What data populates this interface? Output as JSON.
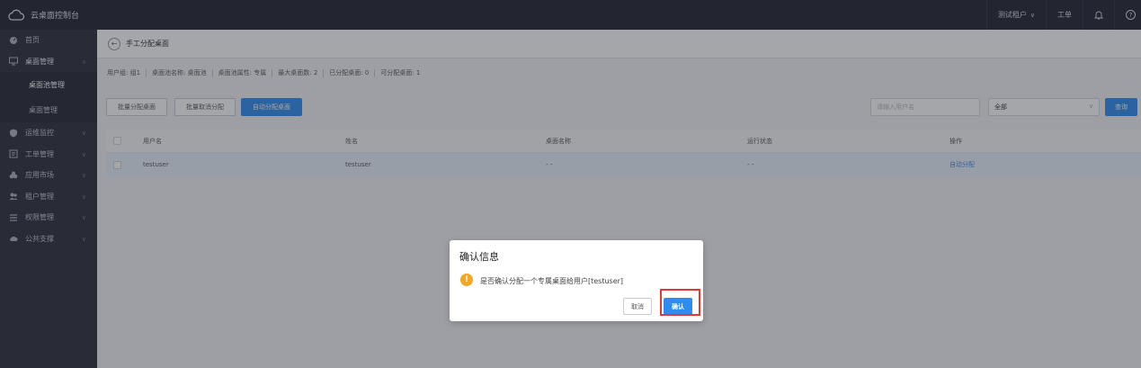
{
  "topbar": {
    "app_title": "云桌面控制台",
    "user": "测试租户",
    "ticket": "工单"
  },
  "sidebar": {
    "items": [
      {
        "label": "首页",
        "icon": "dashboard-icon"
      },
      {
        "label": "桌面管理",
        "icon": "monitor-icon",
        "expanded": true,
        "children": [
          {
            "label": "桌面池管理",
            "active": true
          },
          {
            "label": "桌面管理",
            "active": false
          }
        ]
      },
      {
        "label": "运维监控",
        "icon": "shield-icon"
      },
      {
        "label": "工单管理",
        "icon": "ticket-icon"
      },
      {
        "label": "应用市场",
        "icon": "app-market-icon"
      },
      {
        "label": "租户管理",
        "icon": "tenant-icon"
      },
      {
        "label": "权限管理",
        "icon": "permission-icon"
      },
      {
        "label": "公共支撑",
        "icon": "cloud-icon"
      }
    ]
  },
  "page": {
    "title": "手工分配桌面",
    "info": [
      "用户组: 组1",
      "桌面池名称: 桌面池",
      "桌面池属性: 专属",
      "最大桌面数: 2",
      "已分配桌面: 0",
      "可分配桌面: 1"
    ]
  },
  "toolbar": {
    "batch_assign": "批量分配桌面",
    "batch_unassign": "批量取消分配",
    "auto_assign": "自动分配桌面",
    "search_placeholder": "请输入用户名",
    "filter_value": "全部",
    "query": "查询"
  },
  "table": {
    "headers": [
      "用户名",
      "姓名",
      "桌面名称",
      "运行状态",
      "操作"
    ],
    "rows": [
      {
        "username": "testuser",
        "name": "testuser",
        "desktop": "- -",
        "status": "- -",
        "action": "自动分配"
      }
    ]
  },
  "dialog": {
    "title": "确认信息",
    "message": "是否确认分配一个专属桌面给用户[testuser]",
    "cancel": "取消",
    "confirm": "确认"
  },
  "colors": {
    "topbar_bg": "#1f2230",
    "sidebar_bg": "#2a2d3a",
    "primary": "#2d8cf0",
    "warning": "#f5a623",
    "highlight": "#e53935"
  }
}
